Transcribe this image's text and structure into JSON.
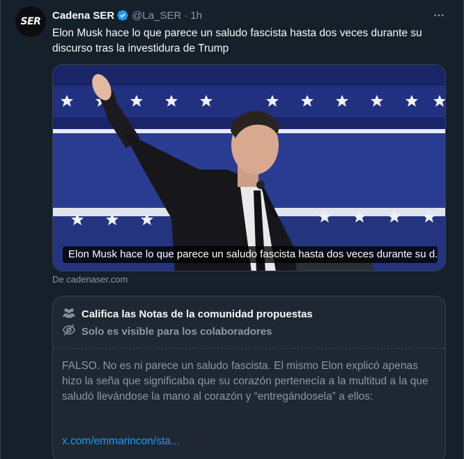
{
  "tweet": {
    "avatar_text": "SER",
    "display_name": "Cadena SER",
    "handle": "@La_SER",
    "separator": "·",
    "time": "1h",
    "text": "Elon Musk hace lo que parece un saludo fascista hasta dos veces durante su discurso tras la investidura de Trump",
    "media_caption": "Elon Musk hace lo que parece un saludo fascista hasta dos veces durante su d...",
    "source": "De cadenaser.com"
  },
  "community_note": {
    "title": "Califica las Notas de la comunidad propuestas",
    "subtitle": "Solo es visible para los colaboradores",
    "body": "FALSO. No es ni parece un saludo fascista. El mismo Elon explicó apenas hizo la seña que significaba que su corazón pertenecía a la multitud a la que saludó llevándose la mano al corazón y “entregándosela” a ellos:",
    "link": "x.com/emmarincon/sta..."
  },
  "colors": {
    "background": "#15202b",
    "text": "#f7f9f9",
    "muted": "#8b98a5",
    "link": "#1d9bf0",
    "verified": "#1d9bf0"
  }
}
